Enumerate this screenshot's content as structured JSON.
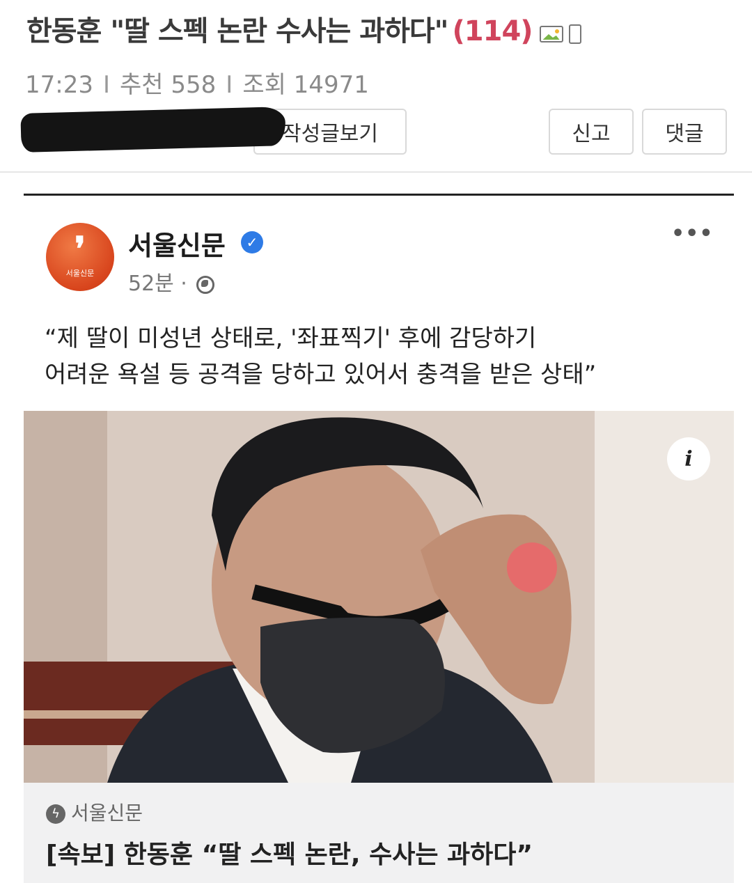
{
  "post": {
    "title": "한동훈 \"딸 스펙 논란 수사는 과하다\"",
    "comment_count": "(114)",
    "time": "17:23",
    "separator": "I",
    "recommend_label": "추천 558",
    "views_label": "조회 14971",
    "author_posts_label": "작성글보기",
    "report_label": "신고",
    "comment_label": "댓글"
  },
  "facebook_post": {
    "page_name": "서울신문",
    "avatar_text": "서울신문",
    "avatar_mark": "❜",
    "time": "52분 ·",
    "more": "•••",
    "quote_line1": "“제 딸이 미성년 상태로, '좌표찍기' 후에 감당하기",
    "quote_line2": "어려운 욕설 등 공격을 당하고 있어서 충격을 받은 상태”",
    "info_glyph": "i",
    "link_source": "서울신문",
    "link_headline": "[속보] 한동훈 “딸 스펙 논란, 수사는 과하다”"
  },
  "icons": {
    "attachment_image": "image-icon",
    "attachment_mobile": "mobile-icon",
    "verified": "verified-badge-icon",
    "globe": "globe-icon",
    "info": "info-icon",
    "source": "lightning-icon"
  },
  "colors": {
    "comment_count": "#d0445c",
    "avatar": "#e0562a",
    "verified": "#2e7be6",
    "link_footer_bg": "#f1f1f2"
  }
}
